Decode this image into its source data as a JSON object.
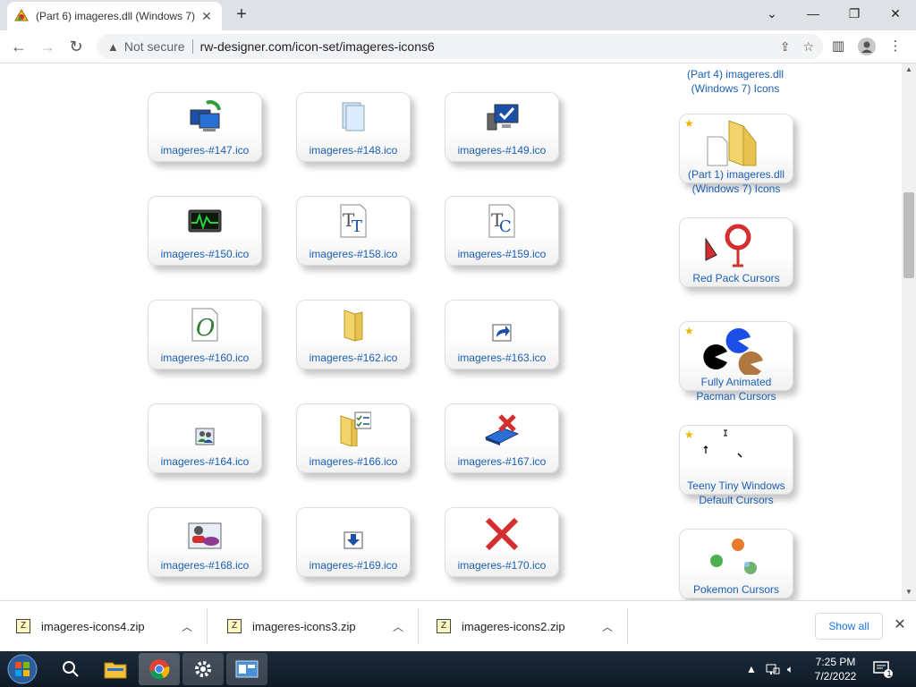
{
  "browser": {
    "tab_title": "(Part 6) imageres.dll (Windows 7)",
    "tab_close": "✕",
    "new_tab": "+",
    "minimize": "⌄",
    "window_min": "—",
    "window_restore": "❐",
    "window_close": "✕",
    "back": "←",
    "forward": "→",
    "reload": "↻",
    "security_text": "Not secure",
    "url": "rw-designer.com/icon-set/imageres-icons6"
  },
  "icons": [
    {
      "label": "imageres-#147.ico",
      "icon": "network-computer-icon"
    },
    {
      "label": "imageres-#148.ico",
      "icon": "documents-stack-icon"
    },
    {
      "label": "imageres-#149.ico",
      "icon": "computer-check-icon"
    },
    {
      "label": "imageres-#150.ico",
      "icon": "performance-monitor-icon"
    },
    {
      "label": "imageres-#158.ico",
      "icon": "truetype-font-icon"
    },
    {
      "label": "imageres-#159.ico",
      "icon": "truetype-collection-icon"
    },
    {
      "label": "imageres-#160.ico",
      "icon": "opentype-font-icon"
    },
    {
      "label": "imageres-#162.ico",
      "icon": "folder-icon"
    },
    {
      "label": "imageres-#163.ico",
      "icon": "shortcut-arrow-icon"
    },
    {
      "label": "imageres-#164.ico",
      "icon": "users-icon"
    },
    {
      "label": "imageres-#166.ico",
      "icon": "folder-checklist-icon"
    },
    {
      "label": "imageres-#167.ico",
      "icon": "disconnect-drive-icon"
    },
    {
      "label": "imageres-#168.ico",
      "icon": "user-accounts-icon"
    },
    {
      "label": "imageres-#169.ico",
      "icon": "download-arrow-icon"
    },
    {
      "label": "imageres-#170.ico",
      "icon": "red-x-icon"
    }
  ],
  "sidebar": {
    "top_link": "(Part 4) imageres.dll (Windows 7) Icons",
    "items": [
      {
        "line1": "(Part 1) imageres.dll",
        "line2": "(Windows 7) Icons",
        "star": true
      },
      {
        "line1": "Red Pack Cursors",
        "line2": "",
        "star": false
      },
      {
        "line1": "Fully Animated",
        "line2": "Pacman Cursors",
        "star": true
      },
      {
        "line1": "Teeny Tiny Windows",
        "line2": "Default Cursors",
        "star": true
      },
      {
        "line1": "Pokemon Cursors",
        "line2": "",
        "star": false
      }
    ]
  },
  "downloads": {
    "items": [
      "imageres-icons4.zip",
      "imageres-icons3.zip",
      "imageres-icons2.zip"
    ],
    "show_all": "Show all"
  },
  "taskbar": {
    "time": "7:25 PM",
    "date": "7/2/2022",
    "notif_count": "1"
  }
}
